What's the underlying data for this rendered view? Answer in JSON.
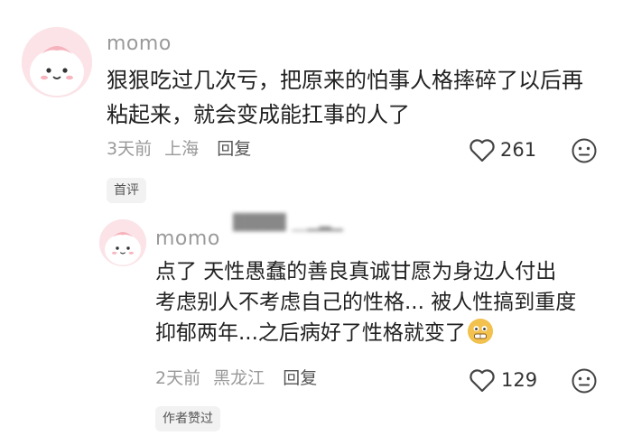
{
  "comments": [
    {
      "username": "momo",
      "content": "狠狠吃过几次亏，把原来的怕事人格摔碎了以后再\n粘起来，就会变成能扛事的人了",
      "time": "3天前",
      "location": "上海",
      "reply_label": "回复",
      "likes": "261",
      "badge": "首评",
      "avatar_icon": "pink-cartoon-avatar",
      "like_icon": "heart-outline-icon",
      "react_icon": "neutral-face-icon"
    }
  ],
  "replies": [
    {
      "username": "momo",
      "content": "点了 天性愚蠢的善良真诚甘愿为身边人付出\n考虑别人不考虑自己的性格... 被人性搞到重度\n抑郁两年...之后病好了性格就变了",
      "time": "2天前",
      "location": "黑龙江",
      "reply_label": "回复",
      "likes": "129",
      "badge": "作者赞过",
      "emoji_icon": "grimacing-face-emoji",
      "avatar_icon": "pink-cartoon-avatar",
      "like_icon": "heart-outline-icon",
      "react_icon": "neutral-face-icon"
    }
  ],
  "blurred_text": "████▌__▁▂▁"
}
